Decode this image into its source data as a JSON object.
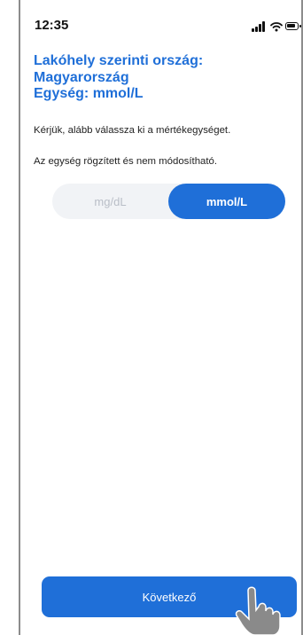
{
  "status_bar": {
    "time": "12:35",
    "icons": [
      "cellular-signal-icon",
      "wifi-icon",
      "battery-icon"
    ]
  },
  "header": {
    "title_line1": "Lakóhely szerinti ország:",
    "title_line2": "Magyarország",
    "title_line3": "Egység: mmol/L"
  },
  "content": {
    "instruction": "Kérjük, alább válassza ki a mértékegységet.",
    "fixed_note": "Az egység rögzített és nem módosítható."
  },
  "unit_selector": {
    "options": [
      "mg/dL",
      "mmol/L"
    ],
    "selected": "mmol/L"
  },
  "footer": {
    "next_label": "Következő"
  },
  "colors": {
    "accent": "#1f6fd8",
    "segment_bg": "#f1f3f6",
    "disabled_text": "#b9bec7"
  }
}
